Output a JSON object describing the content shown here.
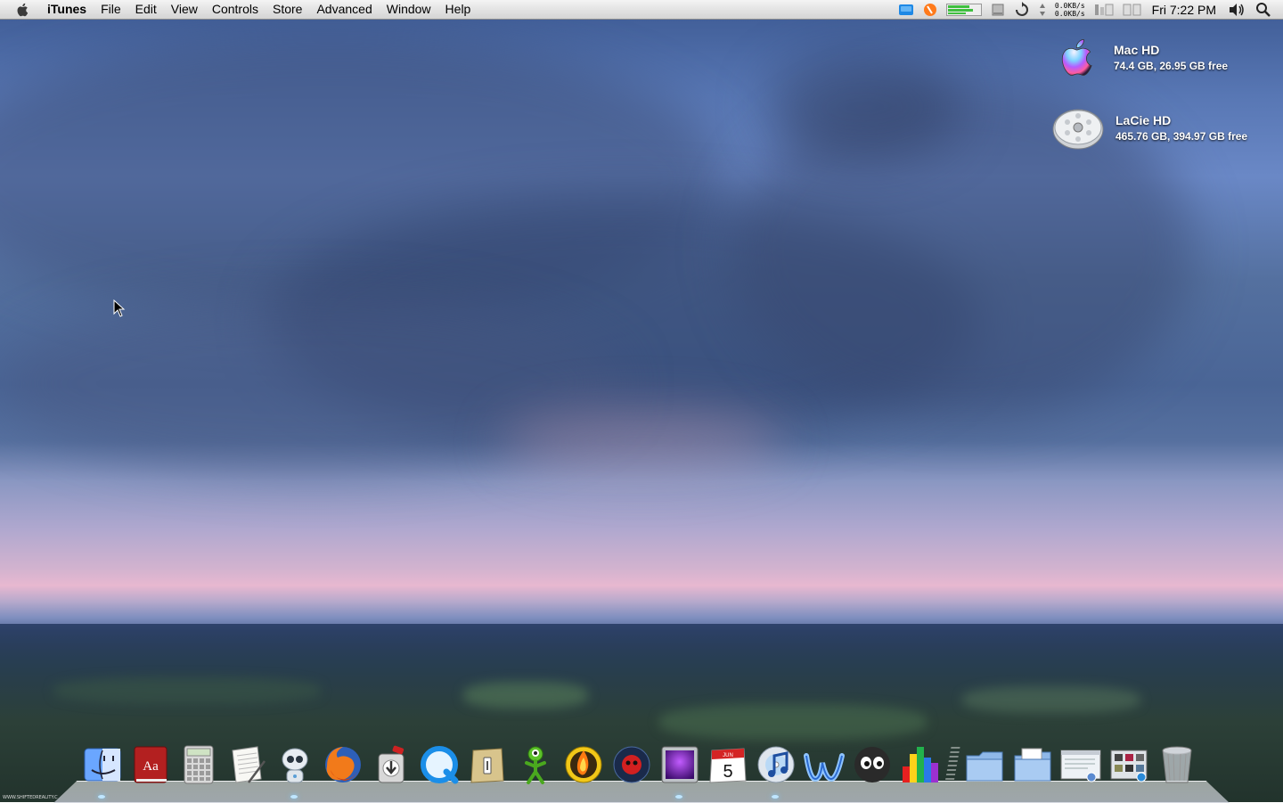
{
  "menubar": {
    "app_name": "iTunes",
    "menus": [
      "File",
      "Edit",
      "View",
      "Controls",
      "Store",
      "Advanced",
      "Window",
      "Help"
    ],
    "net_up": "0.0KB/s",
    "net_down": "0.0KB/s",
    "clock": "Fri 7:22 PM"
  },
  "desktop": {
    "drives": [
      {
        "name": "Mac HD",
        "info": "74.4 GB, 26.95 GB free",
        "icon": "apple-drive-icon"
      },
      {
        "name": "LaCie HD",
        "info": "465.76 GB, 394.97 GB free",
        "icon": "hard-disk-icon"
      }
    ]
  },
  "dock": {
    "calendar_month": "JUN",
    "calendar_day": "5",
    "dictionary_glyph": "Aa",
    "apps": [
      "finder-icon",
      "dictionary-icon",
      "calculator-icon",
      "textedit-icon",
      "robot-icon",
      "firefox-icon",
      "transmission-icon",
      "quicktime-icon",
      "stuffit-icon",
      "adium-icon",
      "burn-icon",
      "spy-icon",
      "purple-app-icon",
      "ical-icon",
      "itunes-icon",
      "wunderlist-icon",
      "eyes-icon",
      "istat-icon",
      "applications-folder-icon",
      "documents-folder-icon",
      "preview-window-icon",
      "photo-stack-icon",
      "trash-icon"
    ]
  },
  "watermark": "WWW.SHIFTEDREALITY.C"
}
